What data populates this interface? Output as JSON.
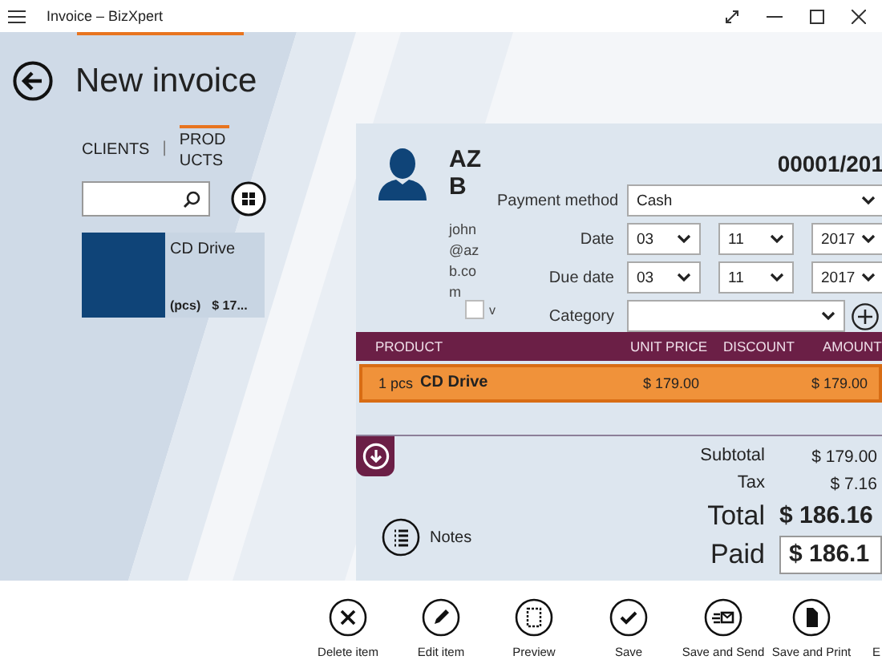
{
  "window": {
    "title": "Invoice – BizXpert"
  },
  "page_title": "New invoice",
  "tabs": [
    {
      "label": "CLIENTS",
      "selected": false
    },
    {
      "label": "PRODUCTS",
      "selected": true
    }
  ],
  "tab_separator": "|",
  "products": [
    {
      "name": "CD Drive",
      "unit": "(pcs)",
      "price": "$ 17..."
    }
  ],
  "client": {
    "name": "AZB",
    "email": "john@azb.com",
    "checkbox_label": "v",
    "checked": false
  },
  "invoice_number": "00001/201",
  "fields": [
    {
      "label": "Payment method",
      "kind": "select",
      "values": [
        "Cash"
      ]
    },
    {
      "label": "Date",
      "kind": "date",
      "values": [
        "03",
        "11",
        "2017"
      ]
    },
    {
      "label": "Due date",
      "kind": "date",
      "values": [
        "03",
        "11",
        "2017"
      ]
    },
    {
      "label": "Category",
      "kind": "category"
    }
  ],
  "table": {
    "columns": [
      "PRODUCT",
      "UNIT PRICE",
      "DISCOUNT",
      "AMOUNT"
    ],
    "rows": [
      {
        "quantity": "1 pcs",
        "product": "CD Drive",
        "unit_price": "$ 179.00",
        "amount": "$ 179.00",
        "selected": true
      }
    ]
  },
  "totals": [
    {
      "label": "Subtotal",
      "value": "$ 179.00",
      "kind": "small"
    },
    {
      "label": "Tax",
      "value": "$ 7.16",
      "kind": "small"
    },
    {
      "label": "Total",
      "value": "$ 186.16",
      "kind": "large"
    },
    {
      "label": "Paid",
      "value": "$ 186.1",
      "kind": "input"
    }
  ],
  "notes": {
    "label": "Notes"
  },
  "actions": [
    {
      "label": "Delete item",
      "kind": "delete"
    },
    {
      "label": "Edit item",
      "kind": "edit"
    },
    {
      "label": "Preview",
      "kind": "preview"
    },
    {
      "label": "Save",
      "kind": "save"
    },
    {
      "label": "Save and Send",
      "kind": "send"
    },
    {
      "label": "Save and Print",
      "kind": "print"
    },
    {
      "label": "E",
      "kind": "none"
    }
  ]
}
